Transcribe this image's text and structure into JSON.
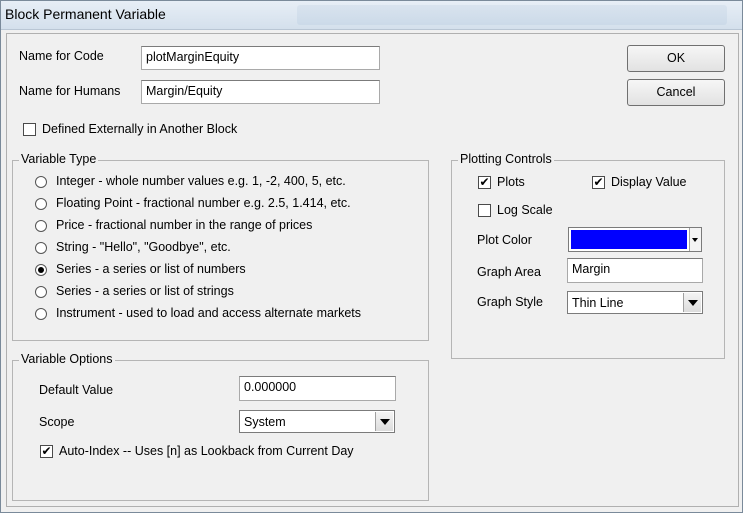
{
  "window": {
    "title": "Block Permanent Variable"
  },
  "buttons": {
    "ok": "OK",
    "cancel": "Cancel"
  },
  "fields": {
    "name_for_code_label": "Name for Code",
    "name_for_code_value": "plotMarginEquity",
    "name_for_humans_label": "Name for Humans",
    "name_for_humans_value": "Margin/Equity",
    "defined_externally_label": "Defined Externally in Another Block",
    "defined_externally_checked": false
  },
  "variable_type": {
    "legend": "Variable Type",
    "options": [
      {
        "label": "Integer - whole number values e.g. 1, -2, 400, 5, etc.",
        "selected": false
      },
      {
        "label": "Floating Point - fractional number e.g. 2.5, 1.414, etc.",
        "selected": false
      },
      {
        "label": "Price - fractional number in the range of prices",
        "selected": false
      },
      {
        "label": "String - \"Hello\", \"Goodbye\", etc.",
        "selected": false
      },
      {
        "label": "Series - a series or list of numbers",
        "selected": true
      },
      {
        "label": "Series - a series or list of strings",
        "selected": false
      },
      {
        "label": "Instrument - used to load and access alternate markets",
        "selected": false
      }
    ]
  },
  "variable_options": {
    "legend": "Variable Options",
    "default_value_label": "Default Value",
    "default_value": "0.000000",
    "scope_label": "Scope",
    "scope_value": "System",
    "auto_index_label": "Auto-Index -- Uses [n] as Lookback from Current Day",
    "auto_index_checked": true
  },
  "plotting_controls": {
    "legend": "Plotting Controls",
    "plots_label": "Plots",
    "plots_checked": true,
    "display_value_label": "Display Value",
    "display_value_checked": true,
    "log_scale_label": "Log Scale",
    "log_scale_checked": false,
    "plot_color_label": "Plot Color",
    "plot_color": "#0000ff",
    "graph_area_label": "Graph Area",
    "graph_area_value": "Margin",
    "graph_style_label": "Graph Style",
    "graph_style_value": "Thin Line"
  },
  "icons": {
    "check": "✔"
  }
}
